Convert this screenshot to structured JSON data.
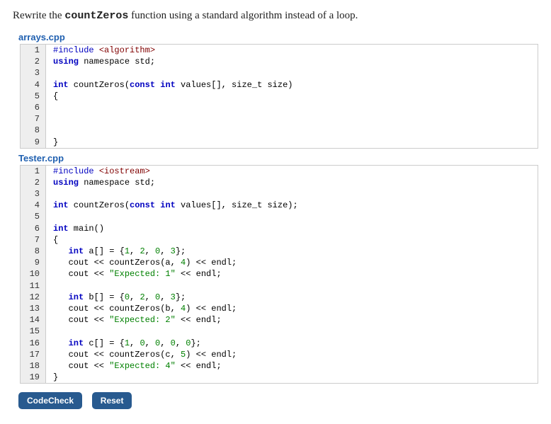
{
  "instruction": {
    "pre": "Rewrite the ",
    "code": "countZeros",
    "post": " function using a standard algorithm instead of a loop."
  },
  "file1": {
    "name": "arrays.cpp",
    "lines": [
      {
        "n": "1",
        "tokens": [
          {
            "t": "#include ",
            "c": "kw-pp"
          },
          {
            "t": "<algorithm>",
            "c": "kw-inc"
          }
        ]
      },
      {
        "n": "2",
        "tokens": [
          {
            "t": "using",
            "c": "kw-ns"
          },
          {
            "t": " namespace std;",
            "c": "ident"
          }
        ]
      },
      {
        "n": "3",
        "tokens": []
      },
      {
        "n": "4",
        "tokens": [
          {
            "t": "int",
            "c": "type"
          },
          {
            "t": " countZeros(",
            "c": "ident"
          },
          {
            "t": "const int",
            "c": "type"
          },
          {
            "t": " values[], size_t size)",
            "c": "ident"
          }
        ]
      },
      {
        "n": "5",
        "tokens": [
          {
            "t": "{",
            "c": "ident"
          }
        ]
      },
      {
        "n": "6",
        "tokens": []
      },
      {
        "n": "7",
        "tokens": []
      },
      {
        "n": "8",
        "tokens": []
      },
      {
        "n": "9",
        "tokens": [
          {
            "t": "}",
            "c": "ident"
          }
        ]
      }
    ]
  },
  "file2": {
    "name": "Tester.cpp",
    "lines": [
      {
        "n": "1",
        "tokens": [
          {
            "t": "#include ",
            "c": "kw-pp"
          },
          {
            "t": "<iostream>",
            "c": "kw-inc"
          }
        ]
      },
      {
        "n": "2",
        "tokens": [
          {
            "t": "using",
            "c": "kw-ns"
          },
          {
            "t": " namespace std;",
            "c": "ident"
          }
        ]
      },
      {
        "n": "3",
        "tokens": []
      },
      {
        "n": "4",
        "tokens": [
          {
            "t": "int",
            "c": "type"
          },
          {
            "t": " countZeros(",
            "c": "ident"
          },
          {
            "t": "const int",
            "c": "type"
          },
          {
            "t": " values[], size_t size);",
            "c": "ident"
          }
        ]
      },
      {
        "n": "5",
        "tokens": []
      },
      {
        "n": "6",
        "tokens": [
          {
            "t": "int",
            "c": "type"
          },
          {
            "t": " main()",
            "c": "ident"
          }
        ]
      },
      {
        "n": "7",
        "tokens": [
          {
            "t": "{",
            "c": "ident"
          }
        ]
      },
      {
        "n": "8",
        "tokens": [
          {
            "t": "   ",
            "c": ""
          },
          {
            "t": "int",
            "c": "type"
          },
          {
            "t": " a[] = {",
            "c": "ident"
          },
          {
            "t": "1",
            "c": "num"
          },
          {
            "t": ", ",
            "c": "ident"
          },
          {
            "t": "2",
            "c": "num"
          },
          {
            "t": ", ",
            "c": "ident"
          },
          {
            "t": "0",
            "c": "num"
          },
          {
            "t": ", ",
            "c": "ident"
          },
          {
            "t": "3",
            "c": "num"
          },
          {
            "t": "};",
            "c": "ident"
          }
        ]
      },
      {
        "n": "9",
        "tokens": [
          {
            "t": "   cout << countZeros(a, ",
            "c": "ident"
          },
          {
            "t": "4",
            "c": "num"
          },
          {
            "t": ") << endl;",
            "c": "ident"
          }
        ]
      },
      {
        "n": "10",
        "tokens": [
          {
            "t": "   cout << ",
            "c": "ident"
          },
          {
            "t": "\"Expected: 1\"",
            "c": "str"
          },
          {
            "t": " << endl;",
            "c": "ident"
          }
        ]
      },
      {
        "n": "11",
        "tokens": []
      },
      {
        "n": "12",
        "tokens": [
          {
            "t": "   ",
            "c": ""
          },
          {
            "t": "int",
            "c": "type"
          },
          {
            "t": " b[] = {",
            "c": "ident"
          },
          {
            "t": "0",
            "c": "num"
          },
          {
            "t": ", ",
            "c": "ident"
          },
          {
            "t": "2",
            "c": "num"
          },
          {
            "t": ", ",
            "c": "ident"
          },
          {
            "t": "0",
            "c": "num"
          },
          {
            "t": ", ",
            "c": "ident"
          },
          {
            "t": "3",
            "c": "num"
          },
          {
            "t": "};",
            "c": "ident"
          }
        ]
      },
      {
        "n": "13",
        "tokens": [
          {
            "t": "   cout << countZeros(b, ",
            "c": "ident"
          },
          {
            "t": "4",
            "c": "num"
          },
          {
            "t": ") << endl;",
            "c": "ident"
          }
        ]
      },
      {
        "n": "14",
        "tokens": [
          {
            "t": "   cout << ",
            "c": "ident"
          },
          {
            "t": "\"Expected: 2\"",
            "c": "str"
          },
          {
            "t": " << endl;",
            "c": "ident"
          }
        ]
      },
      {
        "n": "15",
        "tokens": []
      },
      {
        "n": "16",
        "tokens": [
          {
            "t": "   ",
            "c": ""
          },
          {
            "t": "int",
            "c": "type"
          },
          {
            "t": " c[] = {",
            "c": "ident"
          },
          {
            "t": "1",
            "c": "num"
          },
          {
            "t": ", ",
            "c": "ident"
          },
          {
            "t": "0",
            "c": "num"
          },
          {
            "t": ", ",
            "c": "ident"
          },
          {
            "t": "0",
            "c": "num"
          },
          {
            "t": ", ",
            "c": "ident"
          },
          {
            "t": "0",
            "c": "num"
          },
          {
            "t": ", ",
            "c": "ident"
          },
          {
            "t": "0",
            "c": "num"
          },
          {
            "t": "};",
            "c": "ident"
          }
        ]
      },
      {
        "n": "17",
        "tokens": [
          {
            "t": "   cout << countZeros(c, ",
            "c": "ident"
          },
          {
            "t": "5",
            "c": "num"
          },
          {
            "t": ") << endl;",
            "c": "ident"
          }
        ]
      },
      {
        "n": "18",
        "tokens": [
          {
            "t": "   cout << ",
            "c": "ident"
          },
          {
            "t": "\"Expected: 4\"",
            "c": "str"
          },
          {
            "t": " << endl;",
            "c": "ident"
          }
        ]
      },
      {
        "n": "19",
        "tokens": [
          {
            "t": "}",
            "c": "ident"
          }
        ]
      }
    ]
  },
  "buttons": {
    "codecheck": "CodeCheck",
    "reset": "Reset"
  }
}
